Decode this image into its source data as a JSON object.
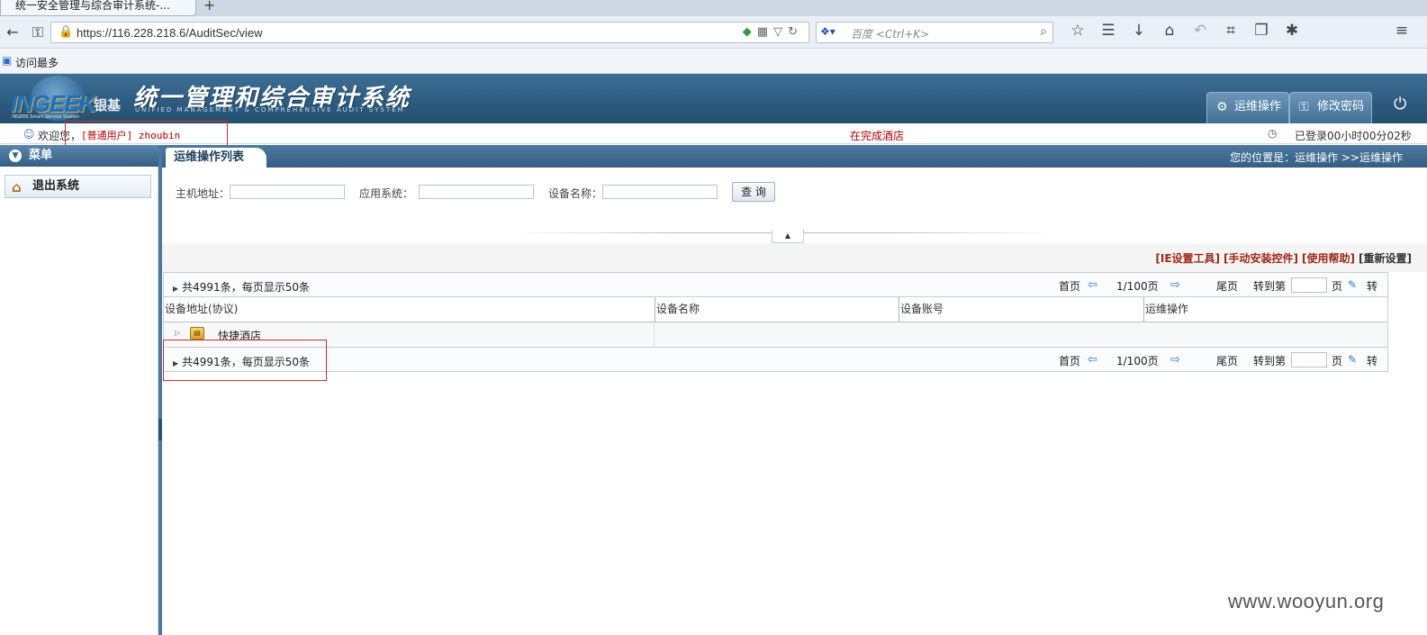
{
  "browser": {
    "tab_title": "统一安全管理与综合审计系统-...",
    "new_tab": "+",
    "url": "https://116.228.218.6/AuditSec/view",
    "search_placeholder": "百度 <Ctrl+K>",
    "bookmark": "访问最多"
  },
  "header": {
    "logo_text": "INGEEK",
    "logo_cn": "银基",
    "logo_tag": "INGEEK Smart Service Station",
    "title": "统一管理和综合审计系统",
    "subtitle": "UNIFIED MANAGEMENT & COMPREHENSIVE AUDIT SYSTEM",
    "tab_ops": "运维操作",
    "tab_password": "修改密码"
  },
  "status": {
    "welcome": "欢迎您，",
    "user": "[普通用户] zhoubin",
    "notice": "在完成酒店",
    "login_time": "已登录00小时00分02秒"
  },
  "sidebar": {
    "title": "菜单",
    "logout": "退出系统"
  },
  "main": {
    "tab": "运维操作列表",
    "breadcrumb": "您的位置是：运维操作 >>运维操作",
    "filter": {
      "host_label": "主机地址：",
      "app_label": "应用系统：",
      "device_label": "设备名称：",
      "query": "查 询"
    },
    "tools": [
      "[IE设置工具]",
      "[手动安装控件]",
      "[使用帮助]",
      "[重新设置]"
    ],
    "pager": {
      "info": "共4991条，每页显示50条",
      "first": "首页",
      "page": "1/100页",
      "last": "尾页",
      "goto": "转到第",
      "page_unit": "页",
      "go": "转"
    },
    "columns": [
      "设备地址(协议)",
      "设备名称",
      "设备账号",
      "运维操作"
    ],
    "rows": [
      {
        "label": "快捷酒店"
      }
    ]
  },
  "watermark": "www.wooyun.org"
}
